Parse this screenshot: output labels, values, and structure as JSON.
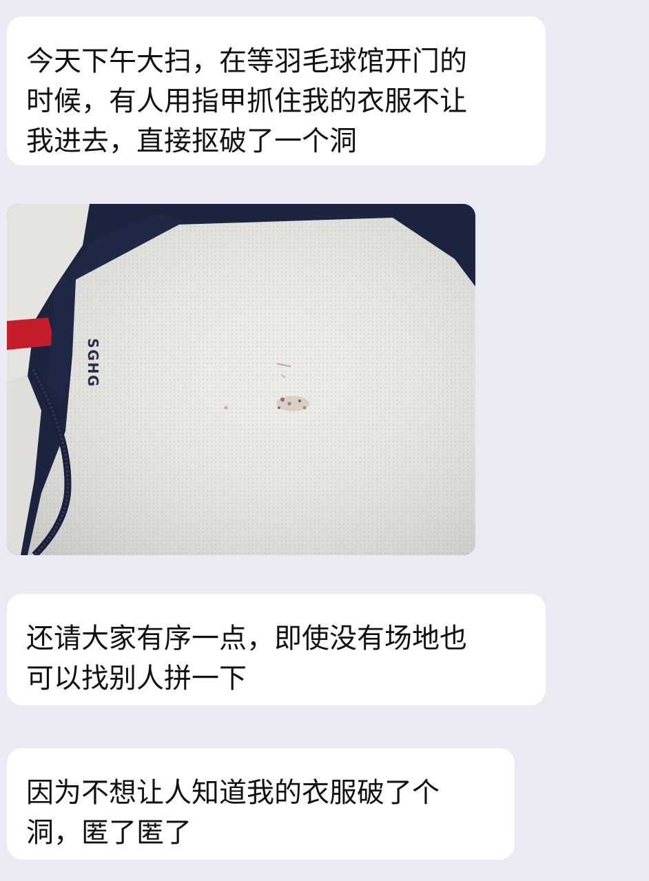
{
  "messages": [
    {
      "type": "text",
      "text": "今天下午大扫，在等羽毛球馆开门的\n时候，有人用指甲抓住我的衣服不让\n我进去，直接抠破了一个洞"
    },
    {
      "type": "photo",
      "shirt_logo": "SGHG"
    },
    {
      "type": "text",
      "text": "还请大家有序一点，即使没有场地也\n可以找别人拼一下"
    },
    {
      "type": "text",
      "text": "因为不想让人知道我的衣服破了个\n洞，匿了匿了"
    }
  ],
  "colors": {
    "background": "#e9eaf4",
    "bubble": "#ffffff",
    "text": "#111111",
    "shirt_white": "#ecebe8",
    "jacket_navy": "#1c2440",
    "accent_red": "#c41e2a"
  }
}
